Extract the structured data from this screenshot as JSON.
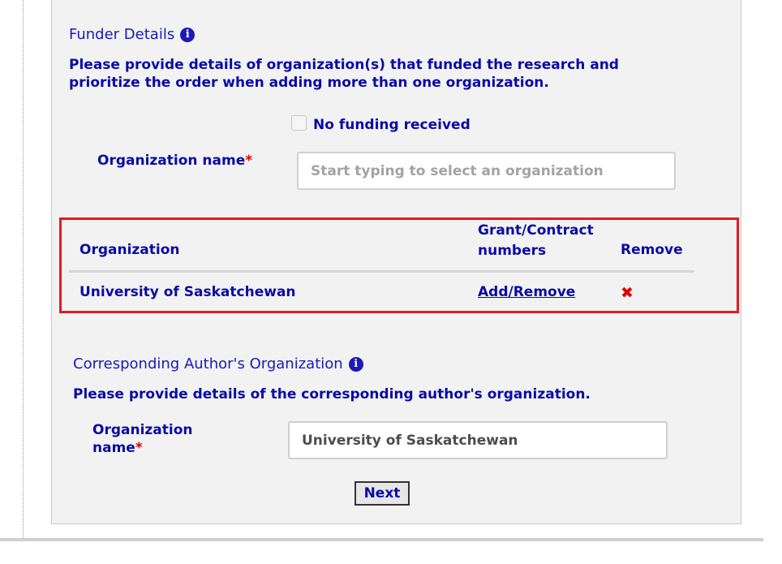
{
  "funder": {
    "title": "Funder Details",
    "info_icon": "i",
    "instructions_line1": "Please provide details of organization(s) that funded the research and",
    "instructions_line2": "prioritize the order when adding more than one organization.",
    "no_funding_label": "No funding received",
    "no_funding_checked": false,
    "org_label": "Organization name",
    "required_mark": "*",
    "org_placeholder": "Start typing to select an organization",
    "org_value": ""
  },
  "table": {
    "headers": {
      "organization": "Organization",
      "grant_line1": "Grant/Contract",
      "grant_line2": "numbers",
      "remove": "Remove"
    },
    "rows": [
      {
        "organization": "University of Saskatchewan",
        "grant_action": "Add/Remove",
        "remove_icon": "✖"
      }
    ]
  },
  "corresponding": {
    "title": "Corresponding Author's Organization",
    "info_icon": "i",
    "instructions": "Please provide details of the corresponding author's organization.",
    "org_label_line1": "Organization",
    "org_label_line2": "name",
    "required_mark": "*",
    "org_value": "University of Saskatchewan"
  },
  "next_label": "Next",
  "colors": {
    "primary": "#0a0aa8",
    "required": "#e00000",
    "highlight_border": "#e21b23",
    "panel_bg": "#f2f2f2"
  }
}
